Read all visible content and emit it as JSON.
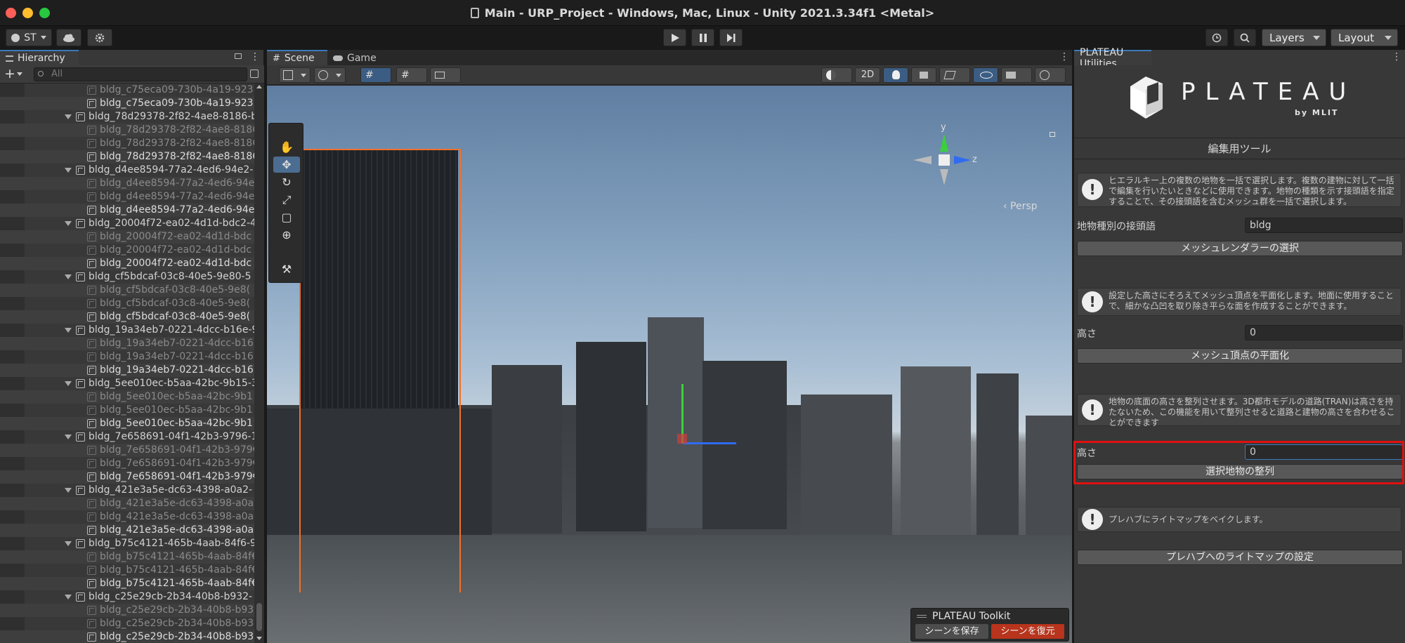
{
  "window": {
    "title": "Main - URP_Project - Windows, Mac, Linux - Unity 2021.3.34f1 <Metal>"
  },
  "toolbar": {
    "account_label": "ST",
    "layers_label": "Layers",
    "layout_label": "Layout"
  },
  "hierarchy": {
    "tab_label": "Hierarchy",
    "search_placeholder": "All",
    "rows": [
      {
        "text": "bldg_c75eca09-730b-4a19-923",
        "kind": "child"
      },
      {
        "text": "bldg_c75eca09-730b-4a19-923",
        "kind": "sel"
      },
      {
        "text": "bldg_78d29378-2f82-4ae8-8186-b",
        "kind": "parent"
      },
      {
        "text": "bldg_78d29378-2f82-4ae8-8186",
        "kind": "child"
      },
      {
        "text": "bldg_78d29378-2f82-4ae8-8186",
        "kind": "child"
      },
      {
        "text": "bldg_78d29378-2f82-4ae8-8186",
        "kind": "sel"
      },
      {
        "text": "bldg_d4ee8594-77a2-4ed6-94e2-",
        "kind": "parent"
      },
      {
        "text": "bldg_d4ee8594-77a2-4ed6-94e",
        "kind": "child"
      },
      {
        "text": "bldg_d4ee8594-77a2-4ed6-94e",
        "kind": "child"
      },
      {
        "text": "bldg_d4ee8594-77a2-4ed6-94e",
        "kind": "sel"
      },
      {
        "text": "bldg_20004f72-ea02-4d1d-bdc2-4",
        "kind": "parent"
      },
      {
        "text": "bldg_20004f72-ea02-4d1d-bdc",
        "kind": "child"
      },
      {
        "text": "bldg_20004f72-ea02-4d1d-bdc",
        "kind": "child"
      },
      {
        "text": "bldg_20004f72-ea02-4d1d-bdc",
        "kind": "sel"
      },
      {
        "text": "bldg_cf5bdcaf-03c8-40e5-9e80-5",
        "kind": "parent"
      },
      {
        "text": "bldg_cf5bdcaf-03c8-40e5-9e8(",
        "kind": "child"
      },
      {
        "text": "bldg_cf5bdcaf-03c8-40e5-9e8(",
        "kind": "child"
      },
      {
        "text": "bldg_cf5bdcaf-03c8-40e5-9e8(",
        "kind": "sel"
      },
      {
        "text": "bldg_19a34eb7-0221-4dcc-b16e-9",
        "kind": "parent"
      },
      {
        "text": "bldg_19a34eb7-0221-4dcc-b16",
        "kind": "child"
      },
      {
        "text": "bldg_19a34eb7-0221-4dcc-b16",
        "kind": "child"
      },
      {
        "text": "bldg_19a34eb7-0221-4dcc-b16",
        "kind": "sel"
      },
      {
        "text": "bldg_5ee010ec-b5aa-42bc-9b15-3",
        "kind": "parent"
      },
      {
        "text": "bldg_5ee010ec-b5aa-42bc-9b1!",
        "kind": "child"
      },
      {
        "text": "bldg_5ee010ec-b5aa-42bc-9b1!",
        "kind": "child"
      },
      {
        "text": "bldg_5ee010ec-b5aa-42bc-9b1!",
        "kind": "sel"
      },
      {
        "text": "bldg_7e658691-04f1-42b3-9796-1",
        "kind": "parent"
      },
      {
        "text": "bldg_7e658691-04f1-42b3-979€",
        "kind": "child"
      },
      {
        "text": "bldg_7e658691-04f1-42b3-979€",
        "kind": "child"
      },
      {
        "text": "bldg_7e658691-04f1-42b3-979€",
        "kind": "sel"
      },
      {
        "text": "bldg_421e3a5e-dc63-4398-a0a2-",
        "kind": "parent"
      },
      {
        "text": "bldg_421e3a5e-dc63-4398-a0a",
        "kind": "child"
      },
      {
        "text": "bldg_421e3a5e-dc63-4398-a0a",
        "kind": "child"
      },
      {
        "text": "bldg_421e3a5e-dc63-4398-a0a",
        "kind": "sel"
      },
      {
        "text": "bldg_b75c4121-465b-4aab-84f6-9",
        "kind": "parent"
      },
      {
        "text": "bldg_b75c4121-465b-4aab-84f€",
        "kind": "child"
      },
      {
        "text": "bldg_b75c4121-465b-4aab-84f€",
        "kind": "child"
      },
      {
        "text": "bldg_b75c4121-465b-4aab-84f€",
        "kind": "sel"
      },
      {
        "text": "bldg_c25e29cb-2b34-40b8-b932-",
        "kind": "parent"
      },
      {
        "text": "bldg_c25e29cb-2b34-40b8-b93",
        "kind": "child"
      },
      {
        "text": "bldg_c25e29cb-2b34-40b8-b93",
        "kind": "child"
      },
      {
        "text": "bldg_c25e29cb-2b34-40b8-b93",
        "kind": "sel"
      }
    ]
  },
  "scene": {
    "tab_scene": "Scene",
    "tab_game": "Game",
    "btn_2d": "2D",
    "axis_y": "y",
    "axis_z": "z",
    "persp_label": "‹ Persp",
    "toolkit": {
      "title": "PLATEAU Toolkit",
      "save": "シーンを保存",
      "restore": "シーンを復元"
    }
  },
  "inspector": {
    "tab_label": "PLATEAU Utilities",
    "logo_text": "PLATEAU",
    "logo_sub": "by MLIT",
    "section_title": "編集用ツール",
    "help1": "ヒエラルキー上の複数の地物を一括で選択します。複数の建物に対して一括で編集を行いたいときなどに使用できます。地物の種類を示す接頭語を指定することで、その接頭語を含むメッシュ群を一括で選択します。",
    "prefix_label": "地物種別の接頭語",
    "prefix_value": "bldg",
    "select_renderers": "メッシュレンダラーの選択",
    "help2": "設定した高さにそろえてメッシュ頂点を平面化します。地面に使用することで、細かな凸凹を取り除き平らな面を作成することができます。",
    "height_label_1": "高さ",
    "height_value_1": "0",
    "flatten_button": "メッシュ頂点の平面化",
    "help3": "地物の底面の高さを整列させます。3D都市モデルの道路(TRAN)は高さを持たないため、この機能を用いて整列させると道路と建物の高さを合わせることができます",
    "height_label_2": "高さ",
    "height_value_2": "0",
    "align_button": "選択地物の整列",
    "help4": "プレハブにライトマップをベイクします。",
    "lightmap_button": "プレハブへのライトマップの設定"
  },
  "colors": {
    "accent": "#3a79bb",
    "highlight_box": "#e01010",
    "selection_outline": "#f0702a"
  }
}
